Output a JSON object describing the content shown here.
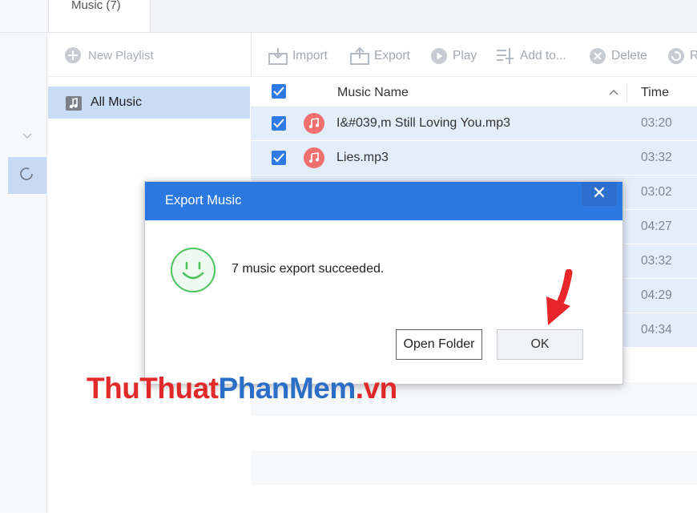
{
  "tabs": {
    "music_tab": "Music (7)"
  },
  "sidebar": {
    "new_playlist": "New Playlist",
    "all_music": "All Music"
  },
  "toolbar": {
    "import": "Import",
    "export": "Export",
    "play": "Play",
    "add_to": "Add to...",
    "delete": "Delete",
    "cut_label": "R"
  },
  "table": {
    "header_name": "Music Name",
    "header_time": "Time",
    "rows": [
      {
        "name": "I&#039,m Still Loving You.mp3",
        "time": "03:20"
      },
      {
        "name": "Lies.mp3",
        "time": "03:32"
      },
      {
        "name": "",
        "time": "03:02"
      },
      {
        "name": "",
        "time": "04:27"
      },
      {
        "name": "",
        "time": "03:32"
      },
      {
        "name": "",
        "time": "04:29"
      },
      {
        "name": "",
        "time": "04:34"
      }
    ]
  },
  "dialog": {
    "title": "Export Music",
    "close": "✕",
    "message": "7 music export succeeded.",
    "open_folder": "Open Folder",
    "ok": "OK"
  },
  "watermark": {
    "part1": "ThuThuat",
    "part2": "PhanMem",
    "part3": ".vn"
  },
  "colors": {
    "accent": "#2b79e0",
    "selection": "#e4eefb",
    "music_icon": "#f06f6f",
    "smiley": "#4cc35e",
    "arrow": "#e8262a"
  }
}
